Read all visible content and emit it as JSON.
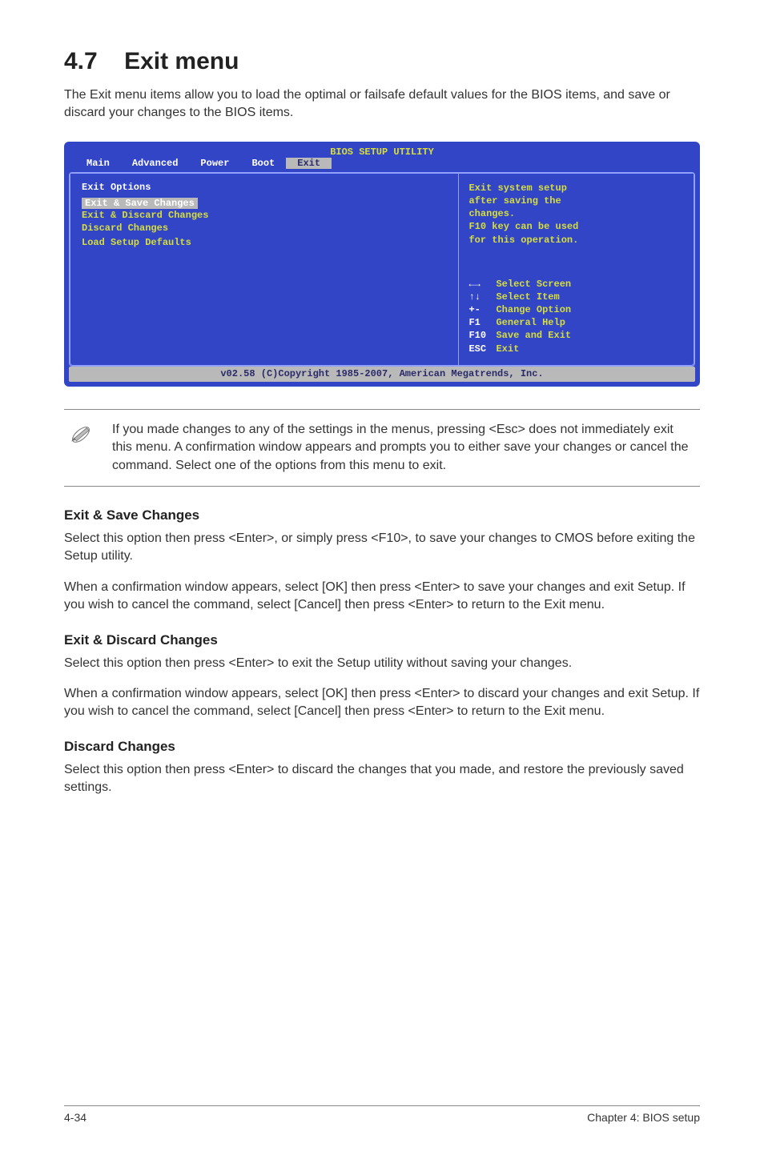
{
  "section": {
    "number": "4.7",
    "title": "Exit menu",
    "intro": "The Exit menu items allow you to load the optimal or failsafe default values for the BIOS items, and save or discard your changes to the BIOS items."
  },
  "bios": {
    "title": "BIOS SETUP UTILITY",
    "tabs": [
      "Main",
      "Advanced",
      "Power",
      "Boot",
      "Exit"
    ],
    "selected_tab": "Exit",
    "left": {
      "heading": "Exit Options",
      "items": [
        {
          "label": "Exit & Save Changes",
          "highlighted": true
        },
        {
          "label": "Exit & Discard Changes",
          "highlighted": false
        },
        {
          "label": "Discard Changes",
          "highlighted": false
        },
        {
          "label": "",
          "highlighted": false
        },
        {
          "label": "Load Setup Defaults",
          "highlighted": false
        }
      ]
    },
    "right": {
      "desc_lines": [
        "Exit system setup",
        "after saving the",
        "changes.",
        "",
        "F10 key can be used",
        "for this operation."
      ],
      "nav": [
        {
          "key": "←→",
          "text": "Select Screen"
        },
        {
          "key": "↑↓",
          "text": "Select Item"
        },
        {
          "key": "+-",
          "text": "Change Option"
        },
        {
          "key": "F1",
          "text": "General Help"
        },
        {
          "key": "F10",
          "text": "Save and Exit"
        },
        {
          "key": "ESC",
          "text": "Exit"
        }
      ]
    },
    "footer": "v02.58 (C)Copyright 1985-2007, American Megatrends, Inc."
  },
  "note": "If you made changes to any of the settings in the menus, pressing <Esc> does not immediately exit this menu. A confirmation window appears and prompts you to either save your changes or cancel the command. Select one of the options from this menu to exit.",
  "groups": [
    {
      "heading": "Exit & Save Changes",
      "paras": [
        "Select this option then press <Enter>, or simply press <F10>, to save your changes to CMOS before exiting the Setup utility.",
        "When a confirmation window appears, select [OK] then press <Enter> to save your changes and exit Setup. If you wish to cancel the command, select [Cancel] then press <Enter> to return to the Exit menu."
      ]
    },
    {
      "heading": "Exit & Discard Changes",
      "paras": [
        "Select this option then press <Enter> to exit the Setup utility without saving your changes.",
        "When a confirmation window appears, select [OK] then press <Enter> to discard your changes and exit Setup. If you wish to cancel the command, select [Cancel] then press <Enter> to return to the Exit menu."
      ]
    },
    {
      "heading": "Discard Changes",
      "paras": [
        "Select this option then press <Enter> to discard the changes that you made, and restore the previously saved settings."
      ]
    }
  ],
  "footer": {
    "left": "4-34",
    "right": "Chapter 4: BIOS setup"
  }
}
